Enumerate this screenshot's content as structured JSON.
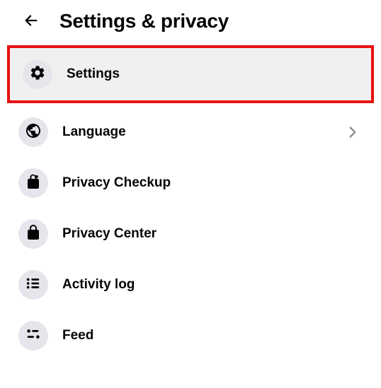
{
  "header": {
    "title": "Settings & privacy"
  },
  "menu": {
    "items": [
      {
        "label": "Settings",
        "icon": "gear-icon",
        "highlighted": true,
        "has_chevron": false
      },
      {
        "label": "Language",
        "icon": "globe-icon",
        "highlighted": false,
        "has_chevron": true
      },
      {
        "label": "Privacy Checkup",
        "icon": "lock-heart-icon",
        "highlighted": false,
        "has_chevron": false
      },
      {
        "label": "Privacy Center",
        "icon": "lock-icon",
        "highlighted": false,
        "has_chevron": false
      },
      {
        "label": "Activity log",
        "icon": "list-icon",
        "highlighted": false,
        "has_chevron": false
      },
      {
        "label": "Feed",
        "icon": "feed-icon",
        "highlighted": false,
        "has_chevron": false
      }
    ]
  }
}
